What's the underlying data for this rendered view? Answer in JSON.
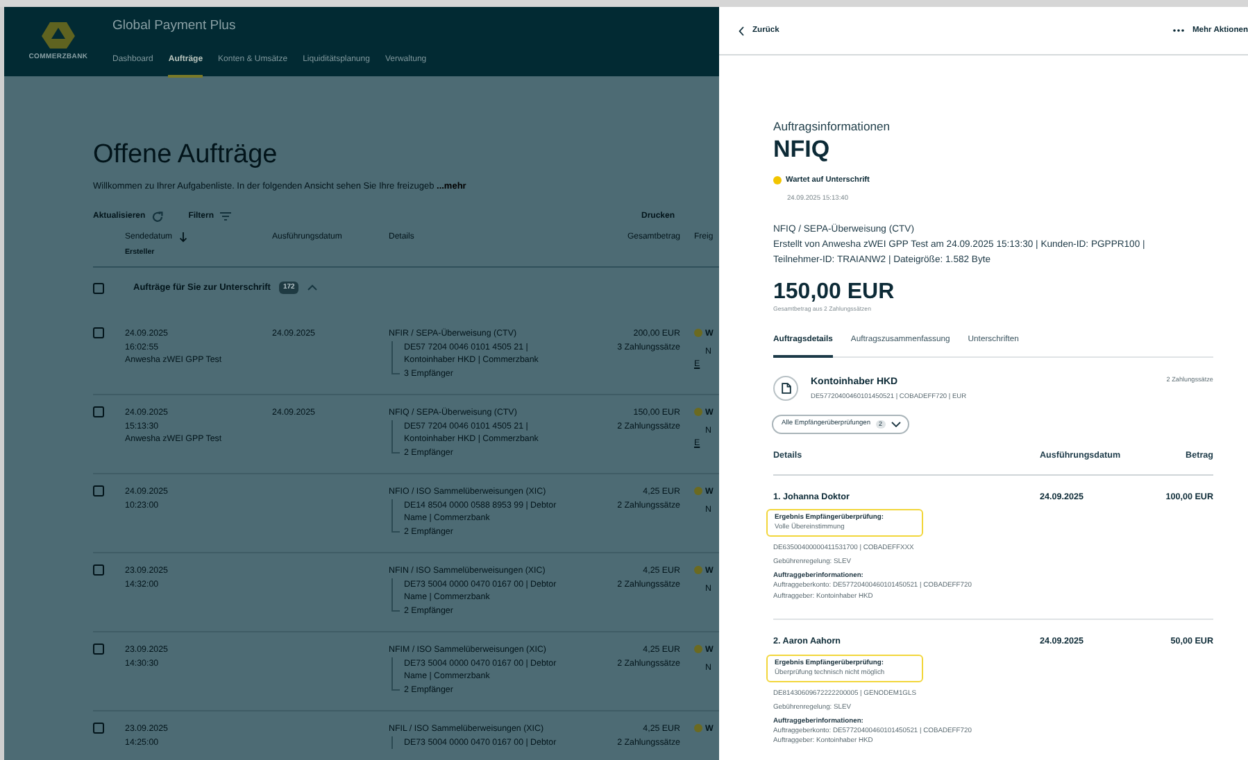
{
  "app": {
    "logo_text": "COMMERZBANK",
    "title": "Global Payment Plus",
    "nav": [
      {
        "label": "Dashboard",
        "selected": false
      },
      {
        "label": "Aufträge",
        "selected": true
      },
      {
        "label": "Konten & Umsätze",
        "selected": false
      },
      {
        "label": "Liquiditätsplanung",
        "selected": false
      },
      {
        "label": "Verwaltung",
        "selected": false
      }
    ]
  },
  "page": {
    "title": "Offene Aufträge",
    "intro": "Willkommen zu Ihrer Aufgabenliste. In der folgenden Ansicht sehen Sie Ihre freizugeb",
    "intro_more": "...mehr",
    "toolbar": {
      "refresh": "Aktualisieren",
      "filter": "Filtern",
      "print": "Drucken"
    },
    "table": {
      "columns": [
        {
          "label": "Sendedatum",
          "sublabel": "Ersteller",
          "sorted": true
        },
        {
          "label": "Ausführungsdatum"
        },
        {
          "label": "Details"
        },
        {
          "label": "Gesamtbetrag"
        },
        {
          "label": "Freig"
        }
      ],
      "group": {
        "label": "Aufträge für Sie zur Unterschrift",
        "count": "172",
        "checked": false,
        "expanded": true
      },
      "rows": [
        {
          "checked": false,
          "date": "24.09.2025",
          "time": "16:02:55",
          "creator": "Anwesha zWEI GPP Test",
          "execution_date": "24.09.2025",
          "title": "NFIR / SEPA-Überweisung (CTV)",
          "account_lines": [
            "DE57 7204 0046 0101 4505 21 |",
            "Kontoinhaber HKD | Commerzbank"
          ],
          "recipients": "3 Empfänger",
          "amount": "200,00 EUR",
          "records": "3 Zahlungssätze",
          "status": "W",
          "note": "N",
          "link": "E"
        },
        {
          "checked": false,
          "date": "24.09.2025",
          "time": "15:13:30",
          "creator": "Anwesha zWEI GPP Test",
          "execution_date": "24.09.2025",
          "title": "NFIQ / SEPA-Überweisung (CTV)",
          "account_lines": [
            "DE57 7204 0046 0101 4505 21 |",
            "Kontoinhaber HKD | Commerzbank"
          ],
          "recipients": "2 Empfänger",
          "amount": "150,00 EUR",
          "records": "2 Zahlungssätze",
          "status": "W",
          "note": "N",
          "link": "E"
        },
        {
          "checked": false,
          "date": "24.09.2025",
          "time": "10:23:00",
          "title": "NFIO / ISO Sammelüberweisungen (XIC)",
          "account_lines": [
            "DE14 8504 0000 0588 8953 99 | Debtor",
            "Name | Commerzbank"
          ],
          "recipients": "2 Empfänger",
          "amount": "4,25 EUR",
          "records": "2 Zahlungssätze",
          "status": "W",
          "note": "N"
        },
        {
          "checked": false,
          "date": "23.09.2025",
          "time": "14:32:00",
          "title": "NFIN / ISO Sammelüberweisungen (XIC)",
          "account_lines": [
            "DE73 5004 0000 0470 0167 00 | Debtor",
            "Name | Commerzbank"
          ],
          "recipients": "2 Empfänger",
          "amount": "4,25 EUR",
          "records": "2 Zahlungssätze",
          "status": "W",
          "note": "N"
        },
        {
          "checked": false,
          "date": "23.09.2025",
          "time": "14:30:30",
          "title": "NFIM / ISO Sammelüberweisungen (XIC)",
          "account_lines": [
            "DE73 5004 0000 0470 0167 00 | Debtor",
            "Name | Commerzbank"
          ],
          "recipients": "2 Empfänger",
          "amount": "4,25 EUR",
          "records": "2 Zahlungssätze",
          "status": "W",
          "note": "N"
        },
        {
          "checked": false,
          "date": "23.09.2025",
          "time": "14:25:00",
          "title": "NFIL / ISO Sammelüberweisungen (XIC)",
          "account_lines": [
            "DE73 5004 0000 0470 0167 00 | Debtor"
          ],
          "amount": "4,25 EUR",
          "records": "2 Zahlungssätze",
          "status": "W"
        }
      ]
    }
  },
  "drawer": {
    "back": "Zurück",
    "more": "Mehr Aktionen",
    "overline": "Auftragsinformationen",
    "title": "NFIQ",
    "status": {
      "label": "Wartet auf Unterschrift",
      "timestamp": "24.09.2025 15:13:40"
    },
    "type_line": "NFIQ / SEPA-Überweisung (CTV)",
    "meta": "Erstellt von Anwesha zWEI GPP Test am 24.09.2025 15:13:30 | Kunden-ID: PGPPR100 | Teilnehmer-ID: TRAIANW2 | Dateigröße: 1.582 Byte",
    "total": "150,00 EUR",
    "total_caption": "Gesamtbetrag aus 2 Zahlungssätzen",
    "tabs": [
      {
        "label": "Auftragsdetails",
        "selected": true
      },
      {
        "label": "Auftragszusammenfassung",
        "selected": false
      },
      {
        "label": "Unterschriften",
        "selected": false
      }
    ],
    "account": {
      "name": "Kontoinhaber HKD",
      "details": "DE57720400460101450521 | COBADEFF720 | EUR",
      "records": "2 Zahlungssätze"
    },
    "check_filter": {
      "label": "Alle Empfängerüberprüfungen",
      "count": "2"
    },
    "columns": [
      "Details",
      "Ausführungsdatum",
      "Betrag"
    ],
    "payments": [
      {
        "name": "1. Johanna Doktor",
        "date": "24.09.2025",
        "amount": "100,00 EUR",
        "highlighted": true,
        "check_label": "Ergebnis Empfängerüberprüfung:",
        "check_result": "Volle Übereinstimmung",
        "account": "DE63500400000411531700 | COBADEFFXXX",
        "fees": "Gebührenregelung: SLEV",
        "payer_heading": "Auftraggeberinformationen:",
        "payer_account": "Auftraggeberkonto: DE57720400460101450521 | COBADEFF720",
        "payer": "Auftraggeber: Kontoinhaber HKD"
      },
      {
        "name": "2. Aaron Aahorn",
        "date": "24.09.2025",
        "amount": "50,00 EUR",
        "highlighted": true,
        "check_label": "Ergebnis Empfängerüberprüfung:",
        "check_result": "Überprüfung technisch nicht möglich",
        "account": "DE81430609672222200005 | GENODEM1GLS",
        "fees": "Gebührenregelung: SLEV",
        "payer_heading": "Auftraggeberinformationen:",
        "payer_account": "Auftraggeberkonto: DE57720400460101450521 | COBADEFF720",
        "payer": "Auftraggeber: Kontoinhaber HKD"
      }
    ]
  }
}
